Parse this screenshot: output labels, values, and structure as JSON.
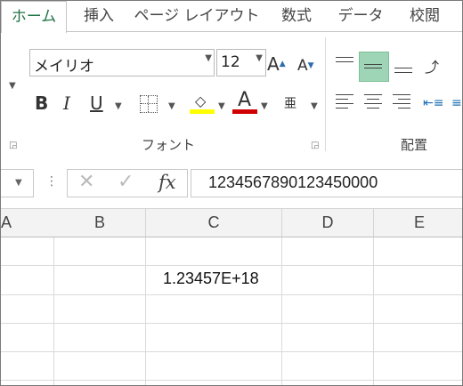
{
  "tabs": [
    {
      "label": "ホーム",
      "active": true
    },
    {
      "label": "挿入"
    },
    {
      "label": "ページ レイアウト"
    },
    {
      "label": "数式"
    },
    {
      "label": "データ"
    },
    {
      "label": "校閲"
    }
  ],
  "ribbon": {
    "font_name": "メイリオ",
    "font_size": "12",
    "grow_label": "A",
    "shrink_label": "A",
    "bold_label": "B",
    "italic_label": "I",
    "underline_label": "U",
    "font_color_letter": "A",
    "furigana_label": "亜",
    "font_group_label": "フォント",
    "alignment_group_label": "配置",
    "fill_color": "#ffff00",
    "font_color": "#d00000",
    "active_color": "#9fd5b7"
  },
  "formula_bar": {
    "fx_label": "fx",
    "value": "123456789012345000 0"
  },
  "columns": [
    "A",
    "B",
    "C",
    "D",
    "E"
  ],
  "cells": {
    "C3": "1.23457E+18"
  }
}
